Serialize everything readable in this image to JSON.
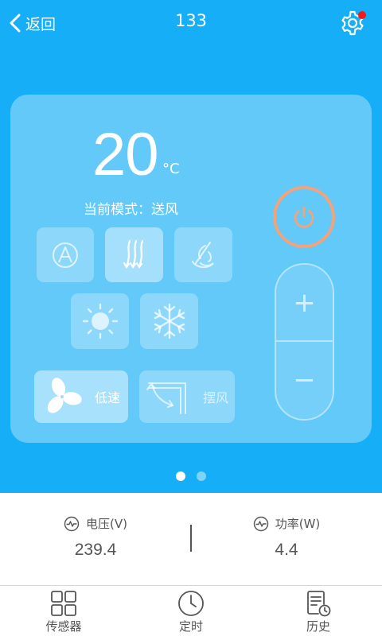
{
  "header": {
    "back_label": "返回",
    "title": "133",
    "settings_icon": "gear-icon",
    "notification_dot_color": "#f21a1a"
  },
  "control": {
    "temperature": "20",
    "temperature_unit": "°C",
    "mode_text": "当前模式：送风",
    "modes": [
      {
        "icon": "auto-mode-icon",
        "active": false
      },
      {
        "icon": "dehumidify-mode-icon",
        "active": true
      },
      {
        "icon": "heat-mode-icon",
        "active": false
      },
      {
        "icon": "sun-mode-icon",
        "active": false
      },
      {
        "icon": "cool-mode-icon",
        "active": false
      }
    ],
    "fan_speed_label": "低速",
    "swing_label": "摆风",
    "power_color": "#f3a27a",
    "plus_label": "+",
    "minus_label": "−"
  },
  "pager": {
    "pages": 2,
    "current": 1
  },
  "stats": {
    "voltage": {
      "label": "电压(V)",
      "value": "239.4"
    },
    "power": {
      "label": "功率(W)",
      "value": "4.4"
    }
  },
  "tabs": [
    {
      "label": "传感器",
      "icon": "grid-icon"
    },
    {
      "label": "定时",
      "icon": "clock-icon"
    },
    {
      "label": "历史",
      "icon": "history-icon"
    }
  ],
  "colors": {
    "primary": "#16aff7",
    "text_gray": "#555555"
  }
}
